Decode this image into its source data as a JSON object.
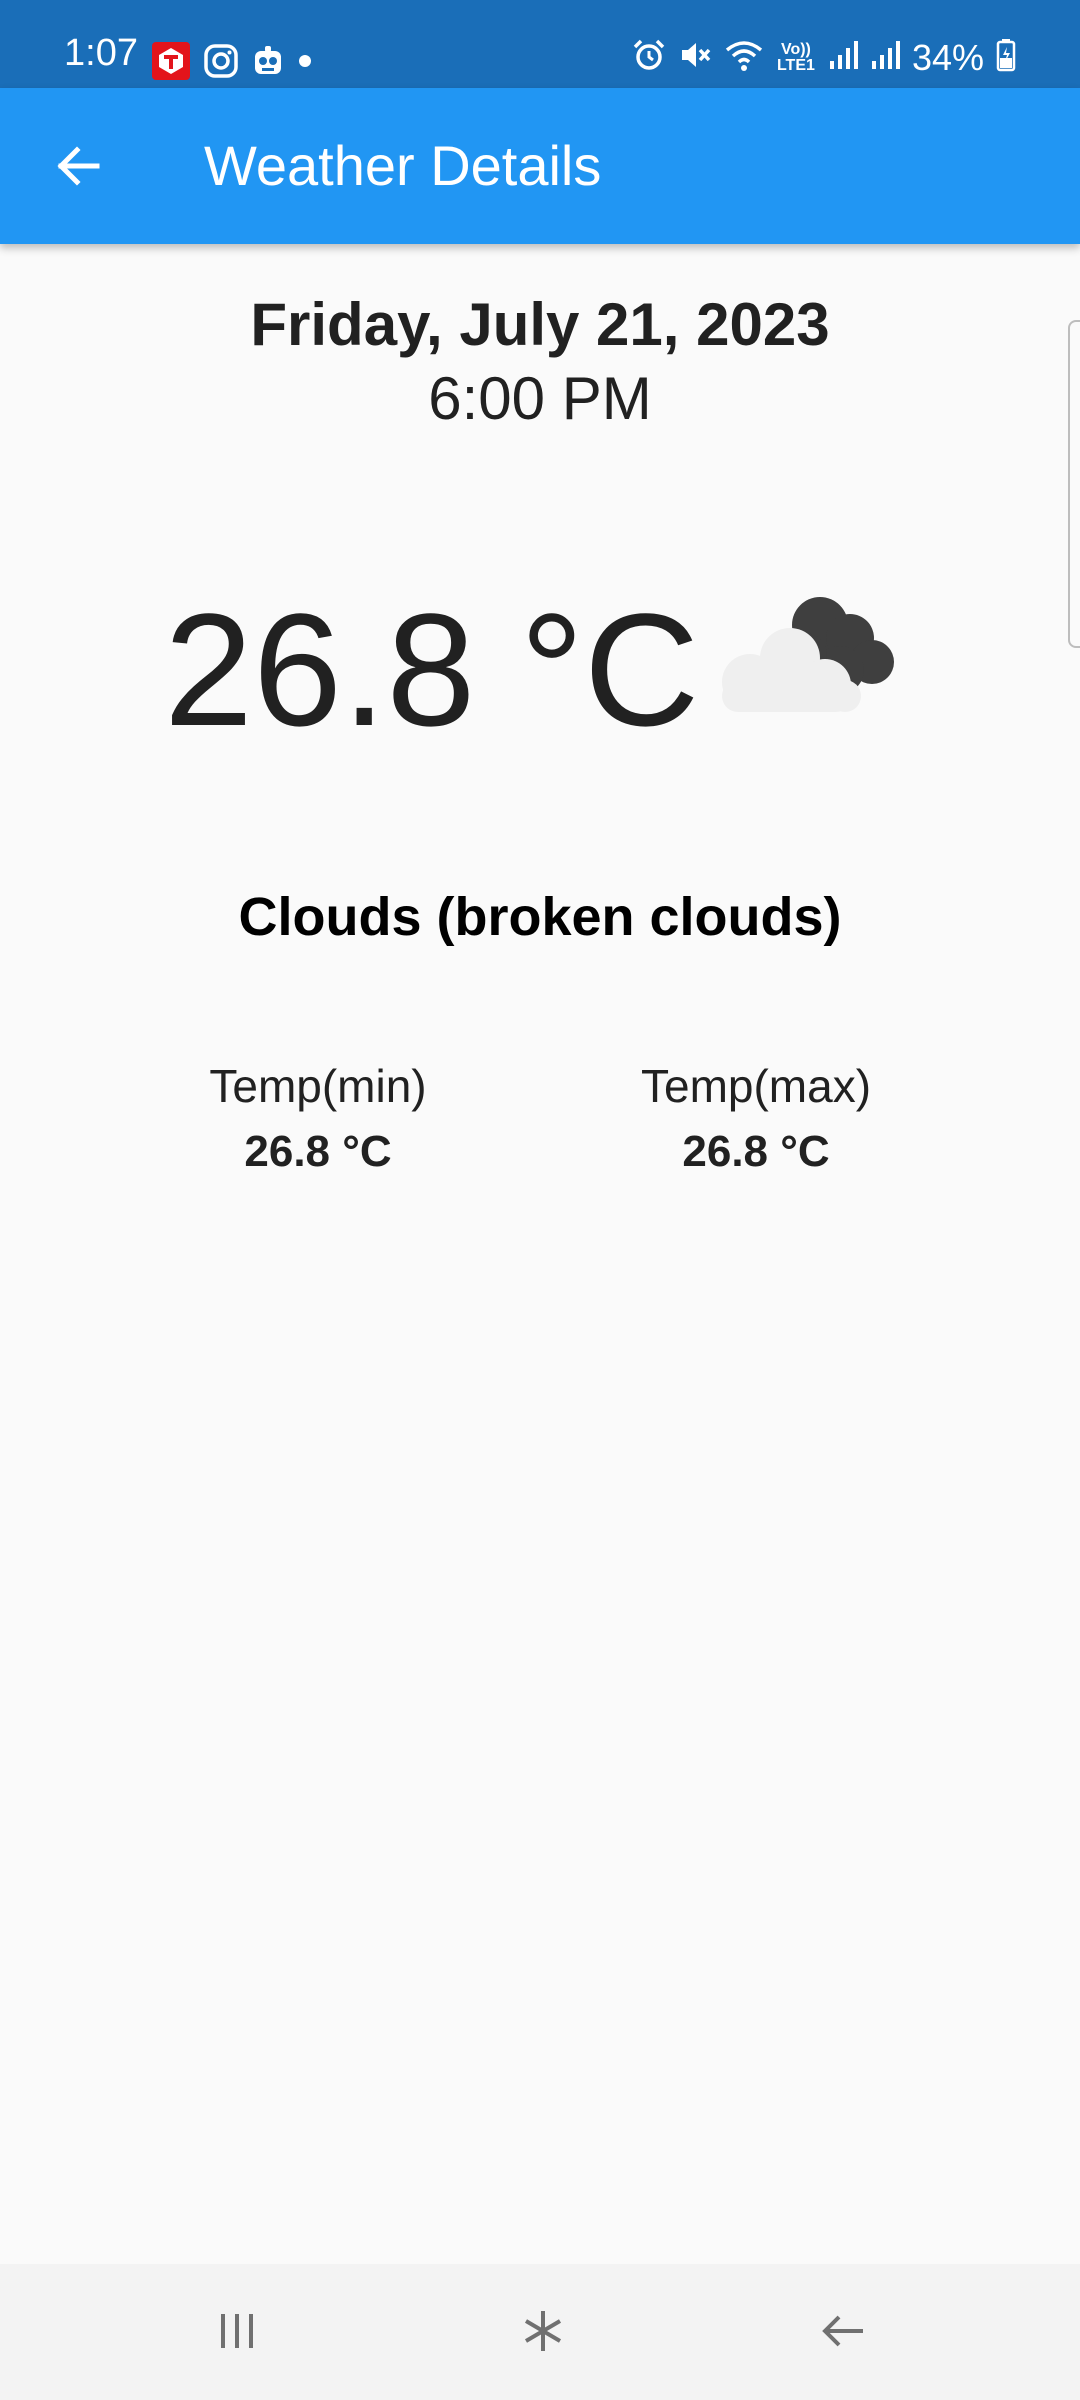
{
  "status_bar": {
    "time": "1:07",
    "battery": "34%",
    "left_icons": [
      "toi-app-icon",
      "instagram-icon",
      "robot-app-icon",
      "dot-icon"
    ],
    "right_icons": [
      "alarm-icon",
      "mute-icon",
      "wifi-icon",
      "volte-icon",
      "signal-icon",
      "signal-icon",
      "battery-icon"
    ],
    "volte_label": "Vo)) LTE1"
  },
  "app_bar": {
    "title": "Weather Details",
    "back_icon": "arrow-left-icon",
    "background": "#2196f3"
  },
  "weather": {
    "date": "Friday, July 21, 2023",
    "time": "6:00 PM",
    "temperature": "26.8 °C",
    "icon": "broken-clouds-icon",
    "condition": "Clouds (broken clouds)",
    "min_label": "Temp(min)",
    "min_value": "26.8 °C",
    "max_label": "Temp(max)",
    "max_value": "26.8 °C"
  },
  "nav_bar": {
    "recent_icon": "recent-apps-icon",
    "home_icon": "home-icon",
    "back_icon": "back-icon"
  },
  "colors": {
    "status_bar": "#1a6eb8",
    "app_bar": "#2196f3",
    "background": "#fafafa"
  }
}
